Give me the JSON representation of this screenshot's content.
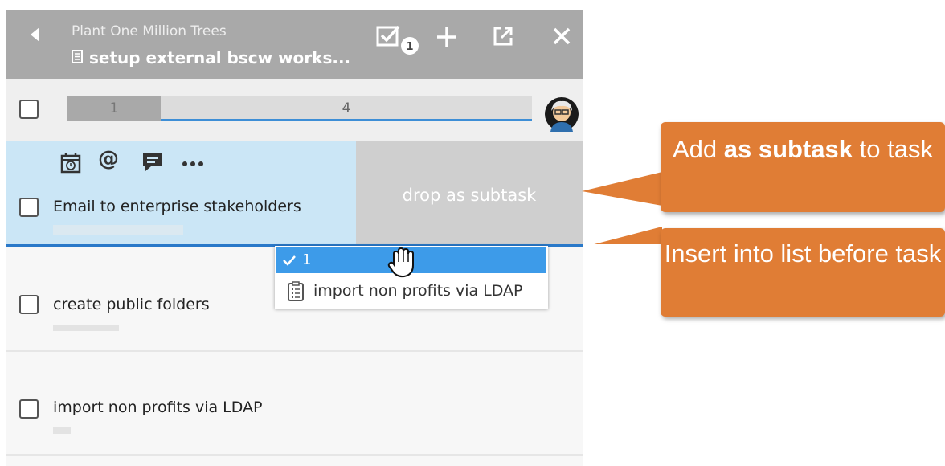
{
  "header": {
    "project": "Plant One Million Trees",
    "task": "setup external bscw works...",
    "badge_count": "1"
  },
  "progress": {
    "done": "1",
    "remaining": "4"
  },
  "tasks": [
    {
      "label": "Email to enterprise stakeholders"
    },
    {
      "label": "create public folders"
    },
    {
      "label": "import non profits via LDAP"
    }
  ],
  "drop_label": "drop as subtask",
  "popup": {
    "selected": "1",
    "item": "import non profits via LDAP"
  },
  "callouts": {
    "subtask_pre": "Add ",
    "subtask_bold": "as subtask",
    "subtask_post": " to task",
    "insert": "Insert into list before task"
  },
  "colors": {
    "header_bg": "#a9a9a9",
    "accent_blue": "#2a79c9",
    "callout_orange": "#e07d35",
    "drag_row_bg": "#cbe6f6"
  }
}
